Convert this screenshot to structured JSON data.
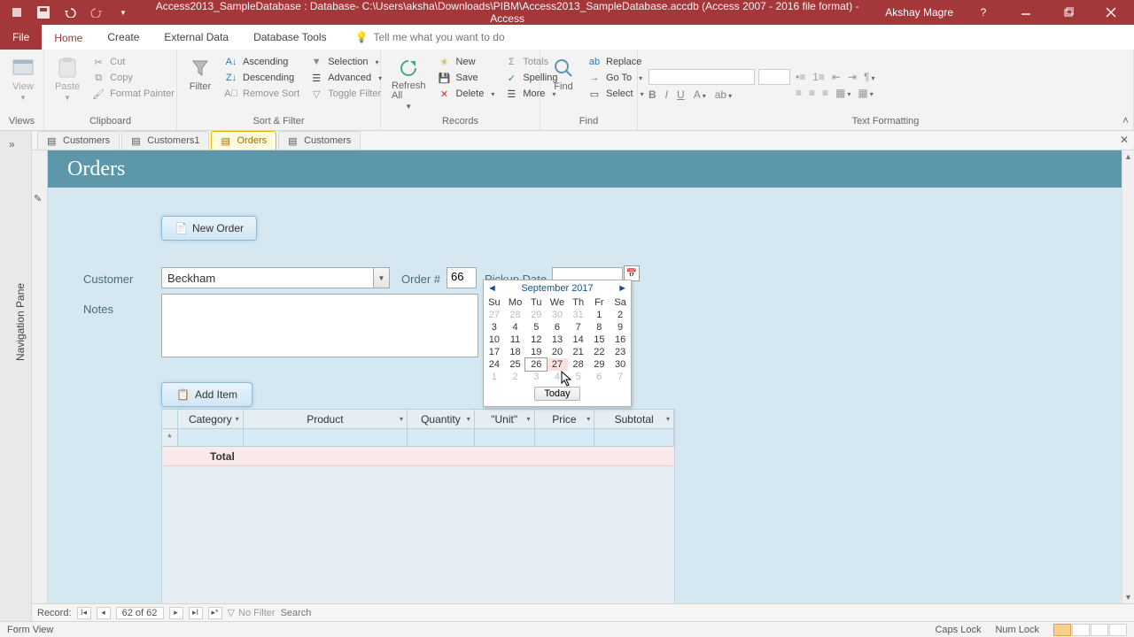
{
  "titlebar": {
    "title": "Access2013_SampleDatabase : Database- C:\\Users\\aksha\\Downloads\\PIBM\\Access2013_SampleDatabase.accdb (Access 2007 - 2016 file format) -  Access",
    "user": "Akshay Magre"
  },
  "menu": {
    "file": "File",
    "home": "Home",
    "create": "Create",
    "external": "External Data",
    "dbtools": "Database Tools",
    "tell": "Tell me what you want to do"
  },
  "ribbon": {
    "views": {
      "view": "View",
      "label": "Views"
    },
    "clipboard": {
      "paste": "Paste",
      "cut": "Cut",
      "copy": "Copy",
      "fmt": "Format Painter",
      "label": "Clipboard"
    },
    "sort": {
      "filter": "Filter",
      "asc": "Ascending",
      "desc": "Descending",
      "rem": "Remove Sort",
      "sel": "Selection",
      "adv": "Advanced",
      "tog": "Toggle Filter",
      "label": "Sort & Filter"
    },
    "records": {
      "refresh": "Refresh All",
      "new": "New",
      "save": "Save",
      "delete": "Delete",
      "totals": "Totals",
      "spell": "Spelling",
      "more": "More",
      "label": "Records"
    },
    "find": {
      "find": "Find",
      "replace": "Replace",
      "goto": "Go To",
      "select": "Select",
      "label": "Find"
    },
    "text": {
      "label": "Text Formatting"
    }
  },
  "nav": {
    "pane": "Navigation Pane"
  },
  "tabs": {
    "t1": "Customers",
    "t2": "Customers1",
    "t3": "Orders",
    "t4": "Customers"
  },
  "form": {
    "title": "Orders",
    "neworder": "New Order",
    "customer_label": "Customer",
    "customer_value": "Beckham",
    "ordernum_label": "Order #",
    "ordernum_value": "66",
    "pickup_label": "Pickup Date",
    "notes_label": "Notes",
    "additem": "Add Item",
    "cols": {
      "category": "Category",
      "product": "Product",
      "quantity": "Quantity",
      "unit": "\"Unit\"",
      "price": "Price",
      "subtotal": "Subtotal"
    },
    "total_label": "Total"
  },
  "calendar": {
    "month": "September 2017",
    "dow": [
      "Su",
      "Mo",
      "Tu",
      "We",
      "Th",
      "Fr",
      "Sa"
    ],
    "today": "Today",
    "weeks": [
      [
        {
          "d": "27",
          "dim": true
        },
        {
          "d": "28",
          "dim": true
        },
        {
          "d": "29",
          "dim": true
        },
        {
          "d": "30",
          "dim": true
        },
        {
          "d": "31",
          "dim": true
        },
        {
          "d": "1"
        },
        {
          "d": "2"
        }
      ],
      [
        {
          "d": "3"
        },
        {
          "d": "4"
        },
        {
          "d": "5"
        },
        {
          "d": "6"
        },
        {
          "d": "7"
        },
        {
          "d": "8"
        },
        {
          "d": "9"
        }
      ],
      [
        {
          "d": "10"
        },
        {
          "d": "11"
        },
        {
          "d": "12"
        },
        {
          "d": "13"
        },
        {
          "d": "14"
        },
        {
          "d": "15"
        },
        {
          "d": "16"
        }
      ],
      [
        {
          "d": "17"
        },
        {
          "d": "18"
        },
        {
          "d": "19"
        },
        {
          "d": "20"
        },
        {
          "d": "21"
        },
        {
          "d": "22"
        },
        {
          "d": "23"
        }
      ],
      [
        {
          "d": "24"
        },
        {
          "d": "25"
        },
        {
          "d": "26",
          "box": true
        },
        {
          "d": "27",
          "hl": true
        },
        {
          "d": "28"
        },
        {
          "d": "29"
        },
        {
          "d": "30"
        }
      ],
      [
        {
          "d": "1",
          "dim": true
        },
        {
          "d": "2",
          "dim": true
        },
        {
          "d": "3",
          "dim": true
        },
        {
          "d": "4",
          "dim": true
        },
        {
          "d": "5",
          "dim": true
        },
        {
          "d": "6",
          "dim": true
        },
        {
          "d": "7",
          "dim": true
        }
      ]
    ]
  },
  "recnav": {
    "label": "Record:",
    "pos": "62 of 62",
    "nofilter": "No Filter",
    "search": "Search"
  },
  "status": {
    "view": "Form View",
    "caps": "Caps Lock",
    "num": "Num Lock"
  }
}
